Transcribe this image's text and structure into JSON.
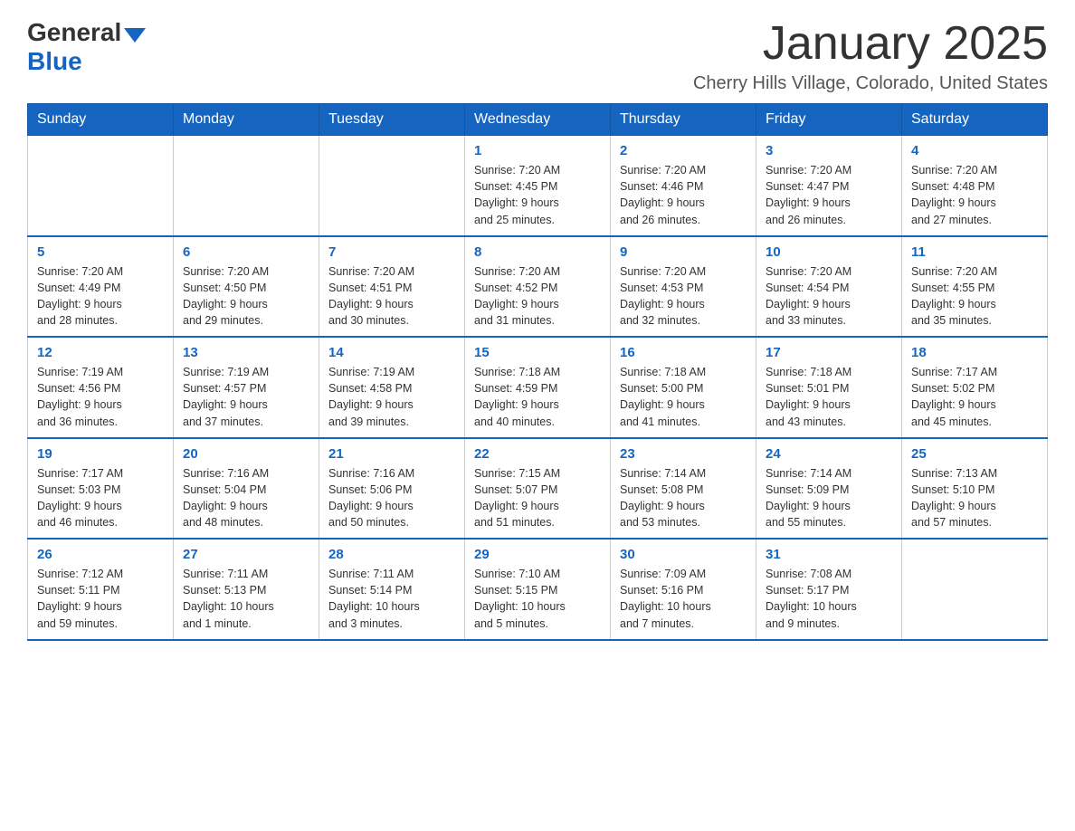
{
  "logo": {
    "general": "General",
    "blue": "Blue"
  },
  "header": {
    "month_title": "January 2025",
    "location": "Cherry Hills Village, Colorado, United States"
  },
  "weekdays": [
    "Sunday",
    "Monday",
    "Tuesday",
    "Wednesday",
    "Thursday",
    "Friday",
    "Saturday"
  ],
  "weeks": [
    [
      {
        "day": "",
        "info": ""
      },
      {
        "day": "",
        "info": ""
      },
      {
        "day": "",
        "info": ""
      },
      {
        "day": "1",
        "info": "Sunrise: 7:20 AM\nSunset: 4:45 PM\nDaylight: 9 hours\nand 25 minutes."
      },
      {
        "day": "2",
        "info": "Sunrise: 7:20 AM\nSunset: 4:46 PM\nDaylight: 9 hours\nand 26 minutes."
      },
      {
        "day": "3",
        "info": "Sunrise: 7:20 AM\nSunset: 4:47 PM\nDaylight: 9 hours\nand 26 minutes."
      },
      {
        "day": "4",
        "info": "Sunrise: 7:20 AM\nSunset: 4:48 PM\nDaylight: 9 hours\nand 27 minutes."
      }
    ],
    [
      {
        "day": "5",
        "info": "Sunrise: 7:20 AM\nSunset: 4:49 PM\nDaylight: 9 hours\nand 28 minutes."
      },
      {
        "day": "6",
        "info": "Sunrise: 7:20 AM\nSunset: 4:50 PM\nDaylight: 9 hours\nand 29 minutes."
      },
      {
        "day": "7",
        "info": "Sunrise: 7:20 AM\nSunset: 4:51 PM\nDaylight: 9 hours\nand 30 minutes."
      },
      {
        "day": "8",
        "info": "Sunrise: 7:20 AM\nSunset: 4:52 PM\nDaylight: 9 hours\nand 31 minutes."
      },
      {
        "day": "9",
        "info": "Sunrise: 7:20 AM\nSunset: 4:53 PM\nDaylight: 9 hours\nand 32 minutes."
      },
      {
        "day": "10",
        "info": "Sunrise: 7:20 AM\nSunset: 4:54 PM\nDaylight: 9 hours\nand 33 minutes."
      },
      {
        "day": "11",
        "info": "Sunrise: 7:20 AM\nSunset: 4:55 PM\nDaylight: 9 hours\nand 35 minutes."
      }
    ],
    [
      {
        "day": "12",
        "info": "Sunrise: 7:19 AM\nSunset: 4:56 PM\nDaylight: 9 hours\nand 36 minutes."
      },
      {
        "day": "13",
        "info": "Sunrise: 7:19 AM\nSunset: 4:57 PM\nDaylight: 9 hours\nand 37 minutes."
      },
      {
        "day": "14",
        "info": "Sunrise: 7:19 AM\nSunset: 4:58 PM\nDaylight: 9 hours\nand 39 minutes."
      },
      {
        "day": "15",
        "info": "Sunrise: 7:18 AM\nSunset: 4:59 PM\nDaylight: 9 hours\nand 40 minutes."
      },
      {
        "day": "16",
        "info": "Sunrise: 7:18 AM\nSunset: 5:00 PM\nDaylight: 9 hours\nand 41 minutes."
      },
      {
        "day": "17",
        "info": "Sunrise: 7:18 AM\nSunset: 5:01 PM\nDaylight: 9 hours\nand 43 minutes."
      },
      {
        "day": "18",
        "info": "Sunrise: 7:17 AM\nSunset: 5:02 PM\nDaylight: 9 hours\nand 45 minutes."
      }
    ],
    [
      {
        "day": "19",
        "info": "Sunrise: 7:17 AM\nSunset: 5:03 PM\nDaylight: 9 hours\nand 46 minutes."
      },
      {
        "day": "20",
        "info": "Sunrise: 7:16 AM\nSunset: 5:04 PM\nDaylight: 9 hours\nand 48 minutes."
      },
      {
        "day": "21",
        "info": "Sunrise: 7:16 AM\nSunset: 5:06 PM\nDaylight: 9 hours\nand 50 minutes."
      },
      {
        "day": "22",
        "info": "Sunrise: 7:15 AM\nSunset: 5:07 PM\nDaylight: 9 hours\nand 51 minutes."
      },
      {
        "day": "23",
        "info": "Sunrise: 7:14 AM\nSunset: 5:08 PM\nDaylight: 9 hours\nand 53 minutes."
      },
      {
        "day": "24",
        "info": "Sunrise: 7:14 AM\nSunset: 5:09 PM\nDaylight: 9 hours\nand 55 minutes."
      },
      {
        "day": "25",
        "info": "Sunrise: 7:13 AM\nSunset: 5:10 PM\nDaylight: 9 hours\nand 57 minutes."
      }
    ],
    [
      {
        "day": "26",
        "info": "Sunrise: 7:12 AM\nSunset: 5:11 PM\nDaylight: 9 hours\nand 59 minutes."
      },
      {
        "day": "27",
        "info": "Sunrise: 7:11 AM\nSunset: 5:13 PM\nDaylight: 10 hours\nand 1 minute."
      },
      {
        "day": "28",
        "info": "Sunrise: 7:11 AM\nSunset: 5:14 PM\nDaylight: 10 hours\nand 3 minutes."
      },
      {
        "day": "29",
        "info": "Sunrise: 7:10 AM\nSunset: 5:15 PM\nDaylight: 10 hours\nand 5 minutes."
      },
      {
        "day": "30",
        "info": "Sunrise: 7:09 AM\nSunset: 5:16 PM\nDaylight: 10 hours\nand 7 minutes."
      },
      {
        "day": "31",
        "info": "Sunrise: 7:08 AM\nSunset: 5:17 PM\nDaylight: 10 hours\nand 9 minutes."
      },
      {
        "day": "",
        "info": ""
      }
    ]
  ]
}
